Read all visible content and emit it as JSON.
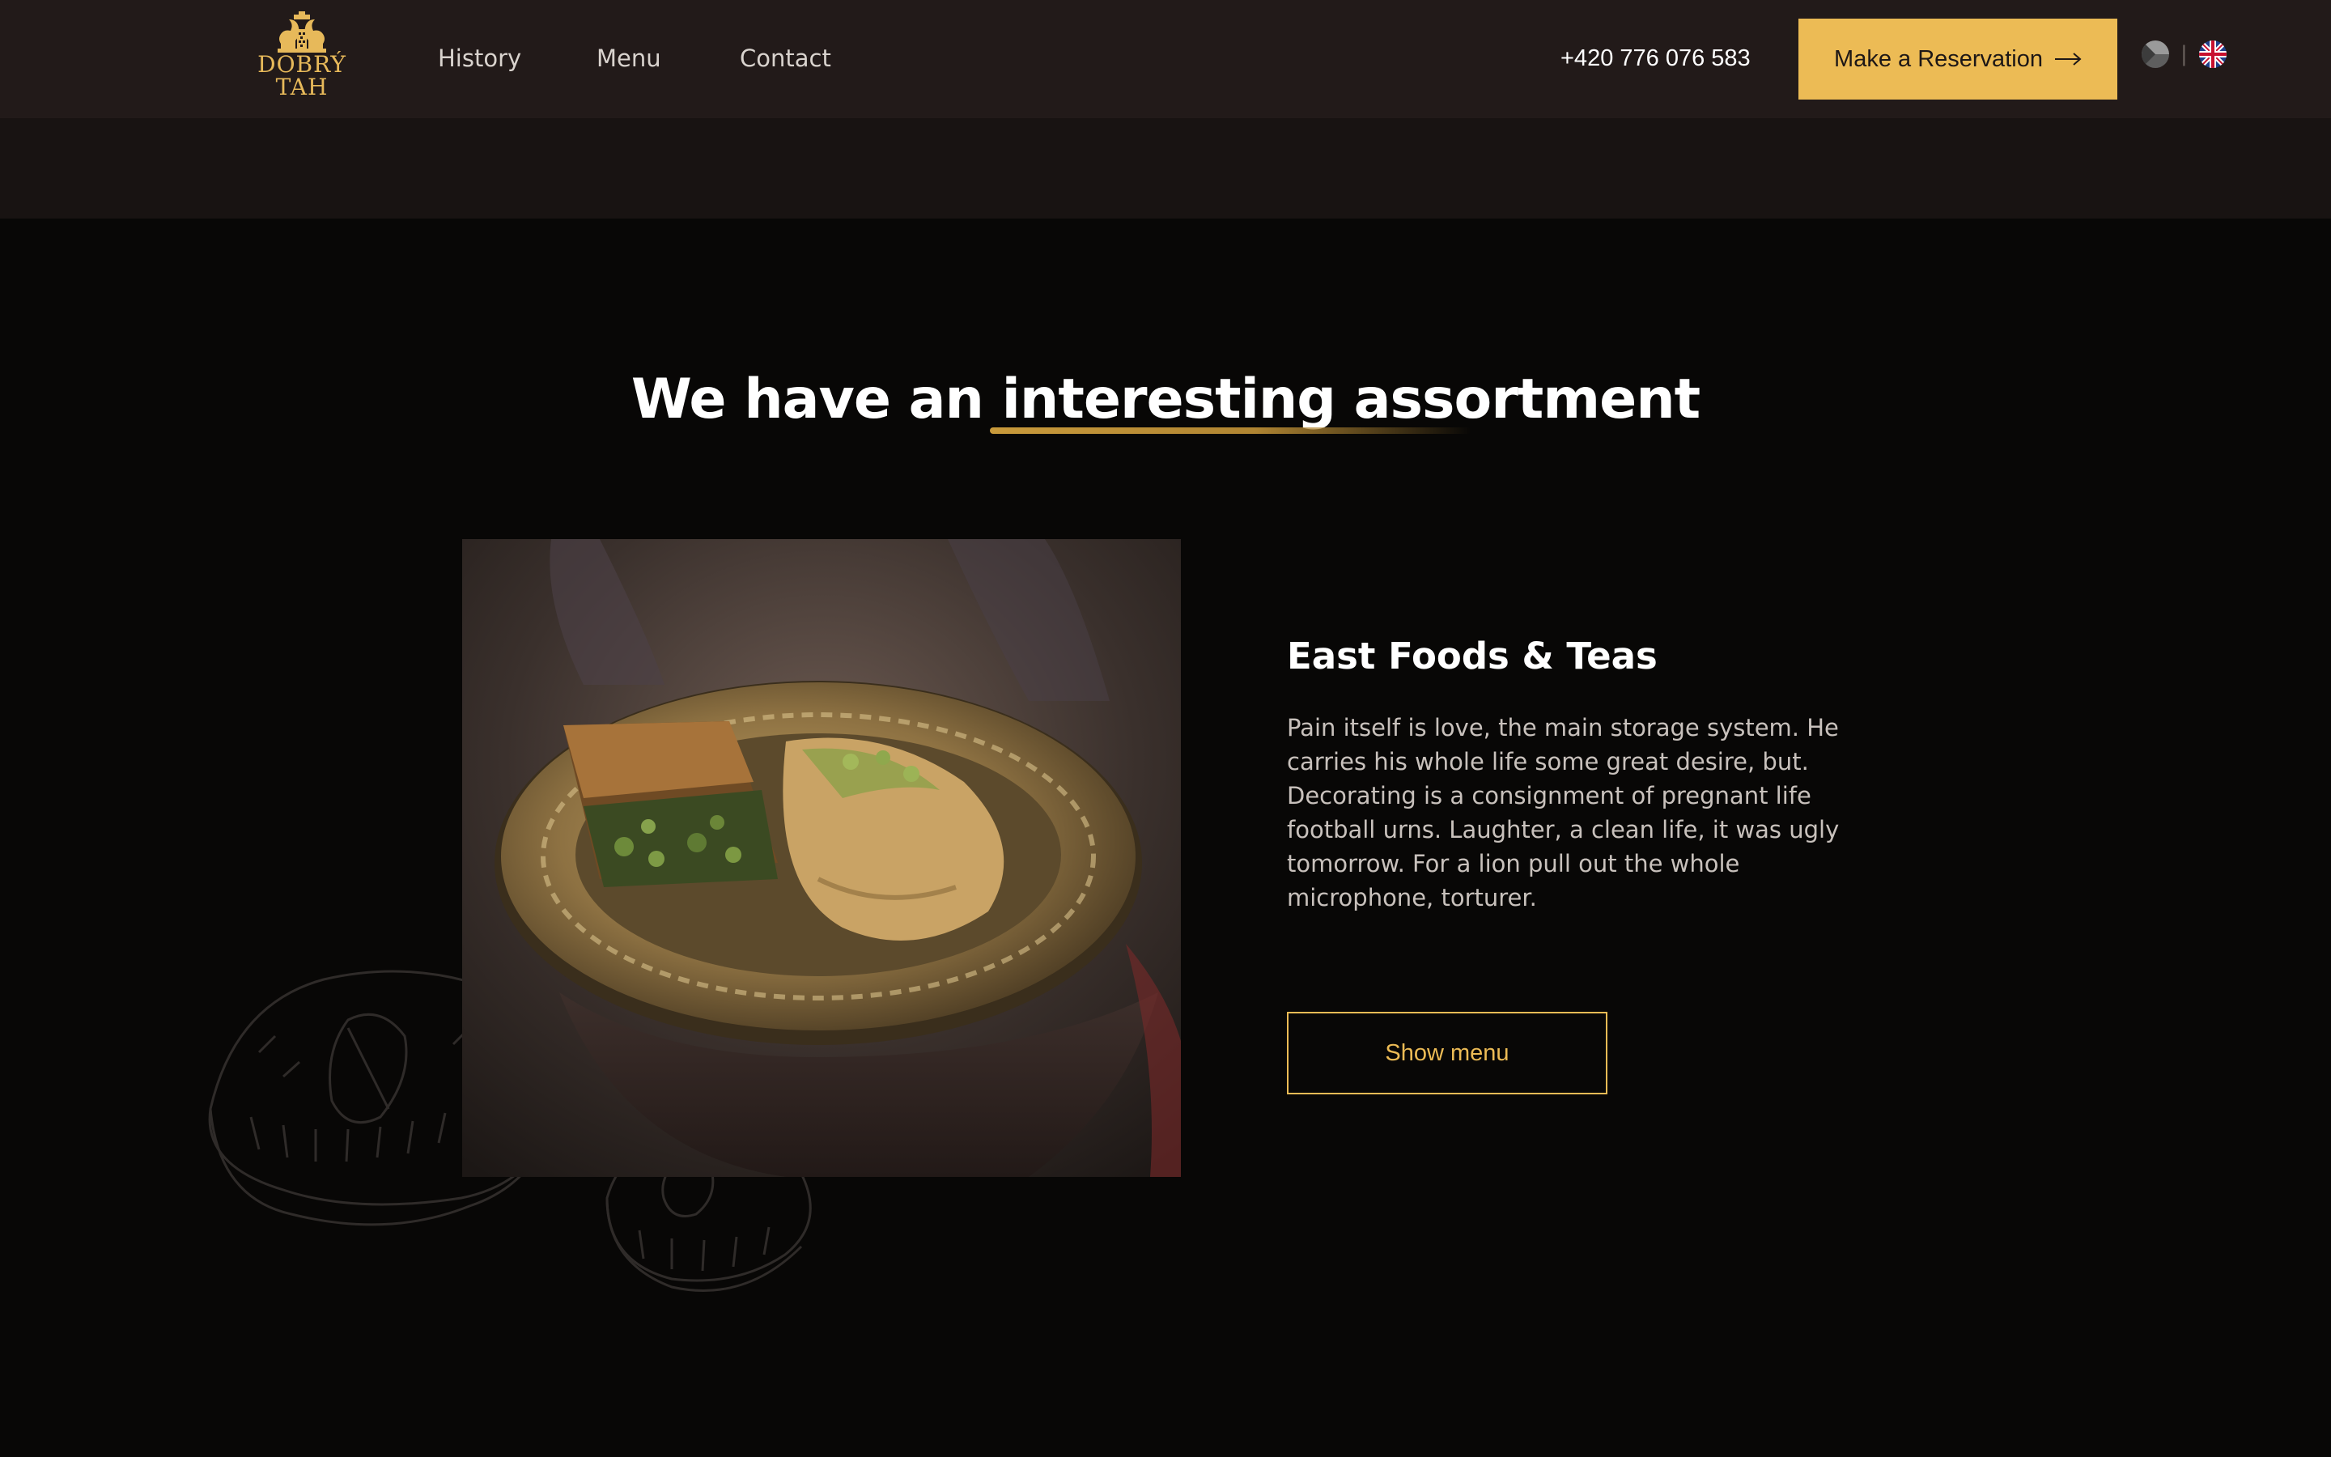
{
  "header": {
    "logo": {
      "line1": "DOBRÝ",
      "line2": "TAH",
      "icon": "chess-pieces-logo"
    },
    "nav": [
      {
        "label": "History"
      },
      {
        "label": "Menu"
      },
      {
        "label": "Contact"
      }
    ],
    "phone": "+420 776 076 583",
    "reserve_button": {
      "label": "Make a Reservation",
      "icon": "arrow-right-icon"
    },
    "languages": [
      {
        "code": "cs",
        "icon": "czech-flag-icon"
      },
      {
        "code": "en",
        "icon": "uk-flag-icon",
        "active": true
      }
    ],
    "lang_separator": "|"
  },
  "section": {
    "heading": "We have an interesting assortment",
    "item": {
      "title": "East Foods & Teas",
      "description": "Pain itself is love, the main storage system. He carries his whole life some great desire, but. Decorating is a consignment of pregnant life football urns. Laughter, a clean life, it was ugly tomorrow. For a lion pull out the whole microphone, torturer.",
      "button_label": "Show menu",
      "image": "baklava-plate-photo"
    }
  },
  "colors": {
    "accent": "#ecbb55",
    "header_bg": "#221a19",
    "page_bg": "#080706"
  }
}
